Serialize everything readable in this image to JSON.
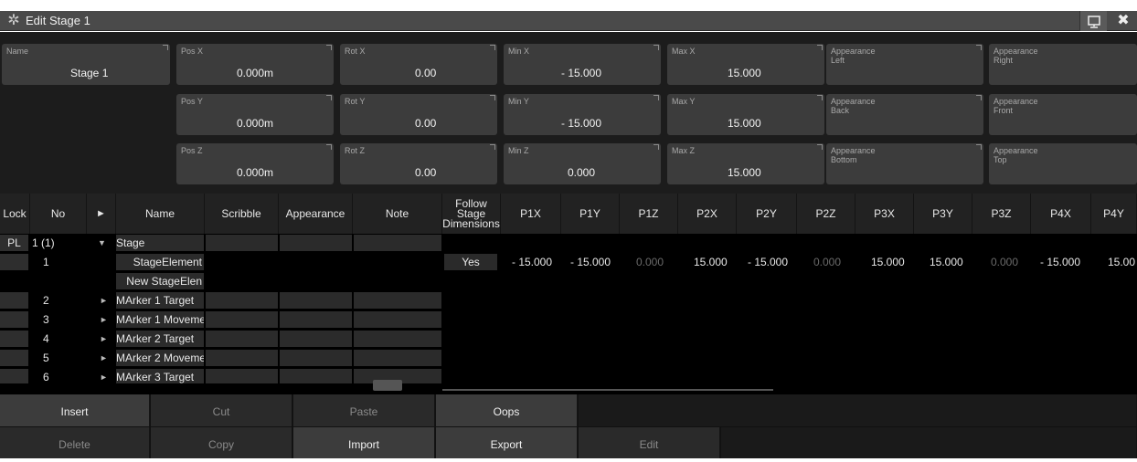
{
  "window": {
    "title": "Edit Stage 1"
  },
  "props": {
    "name": {
      "label": "Name",
      "value": "Stage 1"
    },
    "pos_x": {
      "label": "Pos X",
      "value": "0.000m"
    },
    "pos_y": {
      "label": "Pos Y",
      "value": "0.000m"
    },
    "pos_z": {
      "label": "Pos Z",
      "value": "0.000m"
    },
    "rot_x": {
      "label": "Rot X",
      "value": "0.00"
    },
    "rot_y": {
      "label": "Rot Y",
      "value": "0.00"
    },
    "rot_z": {
      "label": "Rot Z",
      "value": "0.00"
    },
    "min_x": {
      "label": "Min X",
      "value": "- 15.000"
    },
    "min_y": {
      "label": "Min Y",
      "value": "- 15.000"
    },
    "min_z": {
      "label": "Min Z",
      "value": "0.000"
    },
    "max_x": {
      "label": "Max X",
      "value": "15.000"
    },
    "max_y": {
      "label": "Max Y",
      "value": "15.000"
    },
    "max_z": {
      "label": "Max Z",
      "value": "15.000"
    },
    "app_left": {
      "label": "Appearance Left"
    },
    "app_back": {
      "label": "Appearance Back"
    },
    "app_bottom": {
      "label": "Appearance Bottom"
    },
    "app_right": {
      "label": "Appearance Right"
    },
    "app_front": {
      "label": "Appearance Front"
    },
    "app_top": {
      "label": "Appearance Top"
    }
  },
  "table": {
    "headers": {
      "lock": "Lock",
      "no": "No",
      "expand": "►",
      "name": "Name",
      "scribble": "Scribble",
      "appearance": "Appearance",
      "note": "Note",
      "follow": "Follow Stage Dimensions",
      "p1x": "P1X",
      "p1y": "P1Y",
      "p1z": "P1Z",
      "p2x": "P2X",
      "p2y": "P2Y",
      "p2z": "P2Z",
      "p3x": "P3X",
      "p3y": "P3Y",
      "p3z": "P3Z",
      "p4x": "P4X",
      "p4y": "P4Y"
    },
    "rows": [
      {
        "lock": "PL",
        "no": "1 (1)",
        "arrow": "▼",
        "name": "Stage"
      },
      {
        "lock": "",
        "no": "1",
        "arrow": "",
        "name": "StageElement"
      },
      {
        "lock": "",
        "no": "",
        "arrow": "",
        "name": "New StageElen"
      },
      {
        "lock": "",
        "no": "2",
        "arrow": "►",
        "name": "MArker 1 Target"
      },
      {
        "lock": "",
        "no": "3",
        "arrow": "►",
        "name": "MArker 1 Moveme"
      },
      {
        "lock": "",
        "no": "4",
        "arrow": "►",
        "name": "MArker 2 Target"
      },
      {
        "lock": "",
        "no": "5",
        "arrow": "►",
        "name": "MArker 2 Moveme"
      },
      {
        "lock": "",
        "no": "6",
        "arrow": "►",
        "name": "MArker 3 Target"
      }
    ],
    "element_values": {
      "follow": "Yes",
      "p1x": "- 15.000",
      "p1y": "- 15.000",
      "p1z": "0.000",
      "p2x": "15.000",
      "p2y": "- 15.000",
      "p2z": "0.000",
      "p3x": "15.000",
      "p3y": "15.000",
      "p3z": "0.000",
      "p4x": "- 15.000",
      "p4y": "15.00"
    }
  },
  "buttons": {
    "insert": "Insert",
    "cut": "Cut",
    "paste": "Paste",
    "oops": "Oops",
    "delete": "Delete",
    "copy": "Copy",
    "import": "Import",
    "export": "Export",
    "edit": "Edit"
  },
  "colors": {
    "window_bg": "#000000",
    "titlebar": "#4a4a4a",
    "cell_bg": "#3c3c3c",
    "dim_value": "#6a6a6a"
  }
}
